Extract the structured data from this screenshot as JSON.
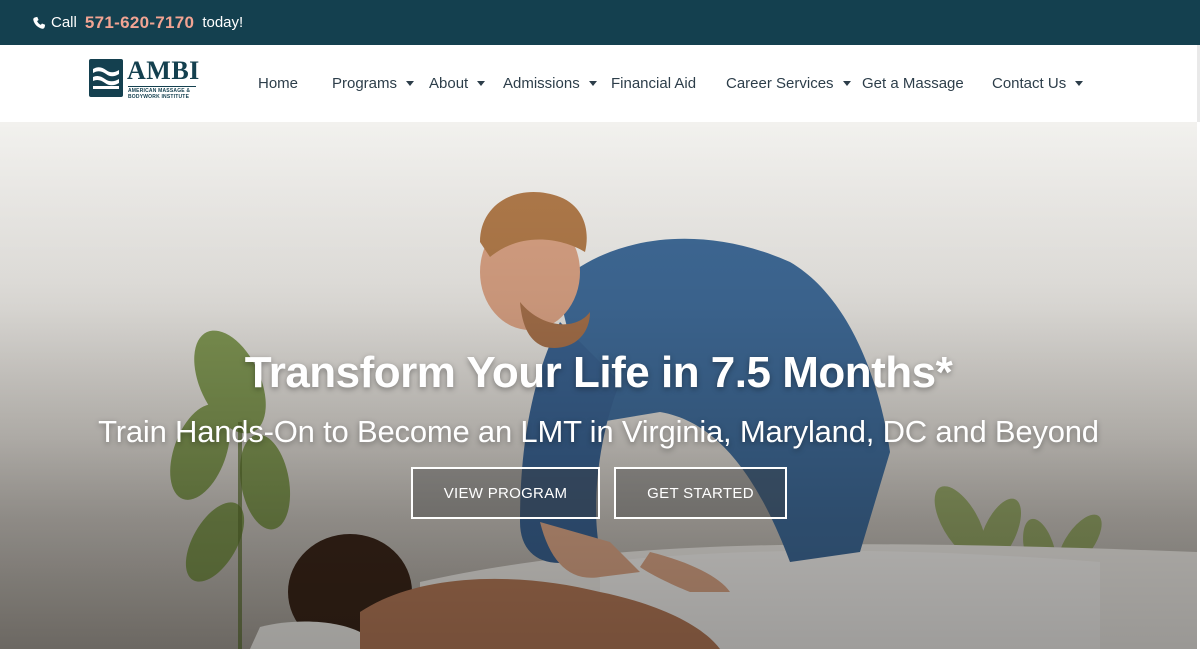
{
  "topbar": {
    "call_prefix": "Call",
    "phone": "571-620-7170",
    "call_suffix": "today!",
    "icon": "phone-icon"
  },
  "logo": {
    "wordmark": "AMBI",
    "tagline": "AMERICAN MASSAGE & BODYWORK INSTITUTE"
  },
  "nav": {
    "items": [
      {
        "label": "Home",
        "dropdown": false
      },
      {
        "label": "Programs",
        "dropdown": true
      },
      {
        "label": "About",
        "dropdown": true
      },
      {
        "label": "Admissions",
        "dropdown": true
      },
      {
        "label": "Financial Aid",
        "dropdown": false
      },
      {
        "label": "Career Services",
        "dropdown": true
      },
      {
        "label": "Get a Massage",
        "dropdown": false
      },
      {
        "label": "Contact Us",
        "dropdown": true
      }
    ]
  },
  "hero": {
    "title": "Transform Your Life in 7.5 Months*",
    "subtitle": "Train Hands-On to Become an LMT in Virginia, Maryland, DC and Beyond",
    "buttons": {
      "view_program": "VIEW PROGRAM",
      "get_started": "GET STARTED"
    }
  },
  "colors": {
    "topbar_bg": "#14404f",
    "phone_accent": "#f2a493",
    "nav_text": "#2d3e4a"
  }
}
